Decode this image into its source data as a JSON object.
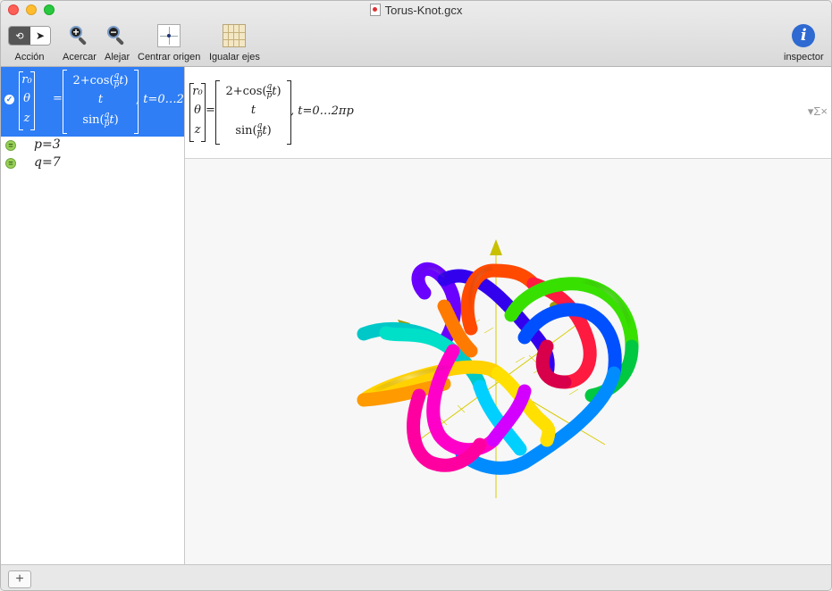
{
  "window": {
    "title": "Torus-Knot.gcx"
  },
  "toolbar": {
    "action_label": "Acción",
    "zoom_in_label": "Acercar",
    "zoom_out_label": "Alejar",
    "center_label": "Centrar origen",
    "equal_axes_label": "Igualar ejes",
    "inspector_label": "inspector",
    "inspector_glyph": "i"
  },
  "sidebar": {
    "selected_expression": {
      "lhs": [
        "r₀",
        "θ",
        "z"
      ],
      "rhs_row1_prefix": "2+cos(",
      "rhs_row2": "t",
      "rhs_row3_prefix": "sin(",
      "frac_num": "q",
      "frac_den": "p",
      "var_t": "t",
      "close_paren": ")",
      "equals": "=",
      "range": ", t=0…2"
    },
    "params": [
      {
        "name": "p",
        "value": "3",
        "text": "p=3"
      },
      {
        "name": "q",
        "value": "7",
        "text": "q=7"
      }
    ]
  },
  "formula_bar": {
    "range": ", t=0…2πp",
    "sigma_label": "▾Σ×"
  },
  "bottom": {
    "add_label": "+"
  },
  "colors": {
    "selection": "#2f7ef5",
    "axis": "#d8cc00",
    "inspector": "#2e6ad1"
  },
  "icons": [
    "check-icon",
    "equation-icon",
    "zoom-in-icon",
    "zoom-out-icon",
    "center-origin-icon",
    "equal-axes-icon",
    "info-icon",
    "plus-icon",
    "cursor-icon",
    "rotate-icon"
  ]
}
